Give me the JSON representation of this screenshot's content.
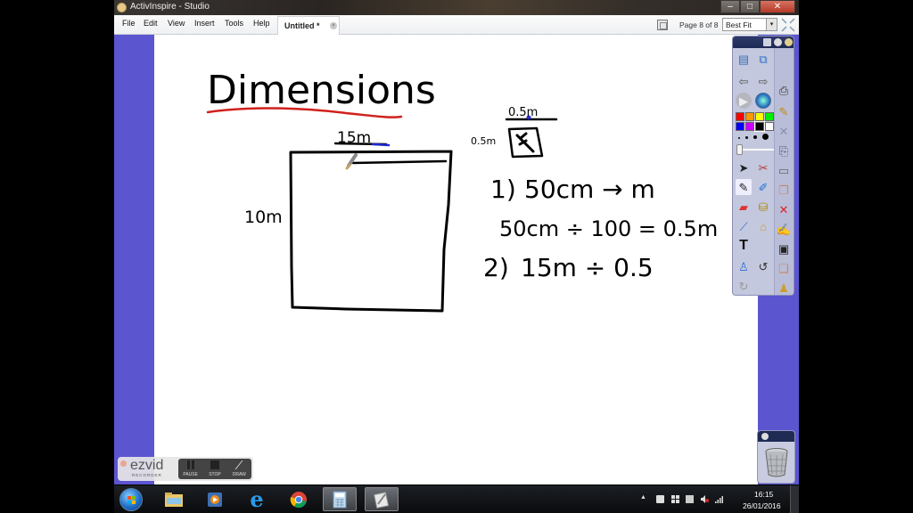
{
  "window": {
    "title": "ActivInspire - Studio",
    "controls": {
      "minimize": "–",
      "maximize": "□",
      "close": "✕"
    }
  },
  "menubar": {
    "items": [
      "File",
      "Edit",
      "View",
      "Insert",
      "Tools",
      "Help"
    ],
    "document_tab": {
      "label": "Untitled *",
      "close": "×"
    },
    "page_indicator": "Page 8 of 8",
    "zoom_select": {
      "value": "Best Fit",
      "dropdown": "▾"
    }
  },
  "flipchart": {
    "heading": "Dimensions",
    "rectangle": {
      "top_label": "15m",
      "side_label": "10m"
    },
    "tile": {
      "top_label": "0.5m",
      "side_label": "0.5m"
    },
    "steps": [
      {
        "number": "1)",
        "text": "50cm → m"
      },
      {
        "number": "",
        "text": "50cm ÷ 100 = 0.5m"
      },
      {
        "number": "2)",
        "text": "15m ÷ 0.5"
      }
    ],
    "colors": {
      "ink": "#000000",
      "underline": "#d0201c",
      "pen_accent": "#1f2ad0"
    }
  },
  "toolbox": {
    "palette": [
      "#ff0000",
      "#ff9900",
      "#ffff00",
      "#00ee00",
      "#0000ff",
      "#cc00ff",
      "#000000",
      "#ffffff"
    ],
    "selected_color": "#000000",
    "tools": [
      "main-menu-icon",
      "browsers-icon",
      "previous-page-icon",
      "next-page-icon",
      "print-icon",
      "play-icon",
      "desktop-globe-icon",
      "desktop-annotate-icon",
      "fullscreen-icon",
      "camera-icon",
      "select-icon",
      "marquee-tools-icon",
      "page-icon",
      "pen-icon",
      "highlighter-icon",
      "duplicate-page-icon",
      "eraser-icon",
      "fill-icon",
      "delete-icon",
      "connector-icon",
      "clear-icon",
      "reset-page-icon",
      "text-icon",
      "save-icon",
      "magic-ink-icon",
      "undo-icon",
      "page-extras-icon",
      "redo-icon",
      "user-icon"
    ]
  },
  "ezvid": {
    "logo": "ezvid",
    "sub": "RECORDER",
    "buttons": [
      "PAUSE",
      "STOP",
      "DRAW"
    ]
  },
  "taskbar": {
    "apps": [
      "file-explorer",
      "media-player",
      "internet-explorer",
      "chrome",
      "calculator",
      "activinspire"
    ],
    "active_apps": [
      "calculator",
      "activinspire"
    ],
    "time": "16:15",
    "date": "26/01/2016"
  }
}
